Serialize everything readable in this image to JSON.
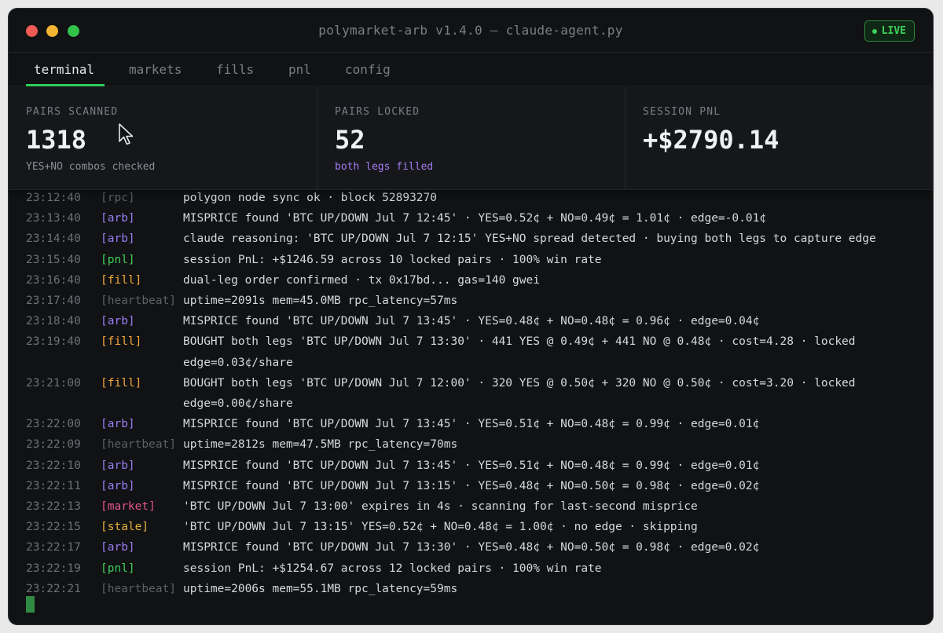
{
  "window": {
    "title": "polymarket-arb v1.4.0 — claude-agent.py",
    "live_label": "LIVE",
    "colors": {
      "accent": "#2fd25c",
      "live": "#3fd05a"
    }
  },
  "tabs": [
    {
      "label": "terminal",
      "active": true
    },
    {
      "label": "markets",
      "active": false
    },
    {
      "label": "fills",
      "active": false
    },
    {
      "label": "pnl",
      "active": false
    },
    {
      "label": "config",
      "active": false
    }
  ],
  "stats": [
    {
      "label": "PAIRS SCANNED",
      "value": "1318",
      "sub": "YES+NO combos checked"
    },
    {
      "label": "PAIRS LOCKED",
      "value": "52",
      "sub": "both legs filled"
    },
    {
      "label": "SESSION PNL",
      "value": "+$2790.14",
      "sub": ""
    }
  ],
  "log": [
    {
      "ts": "23:12:40",
      "tag": "[rpc]",
      "kind": "heartbeat",
      "msg": "polygon node sync ok · block 52893270"
    },
    {
      "ts": "23:13:40",
      "tag": "[arb]",
      "kind": "arb",
      "msg": "MISPRICE found 'BTC UP/DOWN Jul 7 12:45' · YES=0.52¢ + NO=0.49¢ = 1.01¢ · edge=-0.01¢"
    },
    {
      "ts": "23:14:40",
      "tag": "[arb]",
      "kind": "arb",
      "msg": "claude reasoning: 'BTC UP/DOWN Jul 7 12:15' YES+NO spread detected · buying both legs to capture edge"
    },
    {
      "ts": "23:15:40",
      "tag": "[pnl]",
      "kind": "pnl",
      "msg": "session PnL: +$1246.59 across 10 locked pairs · 100% win rate"
    },
    {
      "ts": "23:16:40",
      "tag": "[fill]",
      "kind": "fill",
      "msg": "dual-leg order confirmed · tx 0x17bd... gas=140 gwei"
    },
    {
      "ts": "23:17:40",
      "tag": "[heartbeat]",
      "kind": "heartbeat",
      "msg": "uptime=2091s mem=45.0MB rpc_latency=57ms"
    },
    {
      "ts": "23:18:40",
      "tag": "[arb]",
      "kind": "arb",
      "msg": "MISPRICE found 'BTC UP/DOWN Jul 7 13:45' · YES=0.48¢ + NO=0.48¢ = 0.96¢ · edge=0.04¢"
    },
    {
      "ts": "23:19:40",
      "tag": "[fill]",
      "kind": "fill",
      "msg": "BOUGHT both legs 'BTC UP/DOWN Jul 7 13:30' · 441 YES @ 0.49¢ + 441 NO @ 0.48¢ · cost=4.28 · locked",
      "msg2": "edge=0.03¢/share"
    },
    {
      "ts": "23:21:00",
      "tag": "[fill]",
      "kind": "fill",
      "msg": "BOUGHT both legs 'BTC UP/DOWN Jul 7 12:00' · 320 YES @ 0.50¢ + 320 NO @ 0.50¢ · cost=3.20 · locked",
      "msg2": "edge=0.00¢/share"
    },
    {
      "ts": "23:22:00",
      "tag": "[arb]",
      "kind": "arb",
      "msg": "MISPRICE found 'BTC UP/DOWN Jul 7 13:45' · YES=0.51¢ + NO=0.48¢ = 0.99¢ · edge=0.01¢"
    },
    {
      "ts": "23:22:09",
      "tag": "[heartbeat]",
      "kind": "heartbeat",
      "msg": "uptime=2812s mem=47.5MB rpc_latency=70ms"
    },
    {
      "ts": "23:22:10",
      "tag": "[arb]",
      "kind": "arb",
      "msg": "MISPRICE found 'BTC UP/DOWN Jul 7 13:45' · YES=0.51¢ + NO=0.48¢ = 0.99¢ · edge=0.01¢"
    },
    {
      "ts": "23:22:11",
      "tag": "[arb]",
      "kind": "arb",
      "msg": "MISPRICE found 'BTC UP/DOWN Jul 7 13:15' · YES=0.48¢ + NO=0.50¢ = 0.98¢ · edge=0.02¢"
    },
    {
      "ts": "23:22:13",
      "tag": "[market]",
      "kind": "market",
      "msg": "'BTC UP/DOWN Jul 7 13:00' expires in 4s · scanning for last-second misprice"
    },
    {
      "ts": "23:22:15",
      "tag": "[stale]",
      "kind": "stale",
      "msg": "'BTC UP/DOWN Jul 7 13:15' YES=0.52¢ + NO=0.48¢ = 1.00¢ · no edge · skipping"
    },
    {
      "ts": "23:22:17",
      "tag": "[arb]",
      "kind": "arb",
      "msg": "MISPRICE found 'BTC UP/DOWN Jul 7 13:30' · YES=0.48¢ + NO=0.50¢ = 0.98¢ · edge=0.02¢"
    },
    {
      "ts": "23:22:19",
      "tag": "[pnl]",
      "kind": "pnl",
      "msg": "session PnL: +$1254.67 across 12 locked pairs · 100% win rate"
    },
    {
      "ts": "23:22:21",
      "tag": "[heartbeat]",
      "kind": "heartbeat",
      "msg": "uptime=2006s mem=55.1MB rpc_latency=59ms"
    }
  ]
}
